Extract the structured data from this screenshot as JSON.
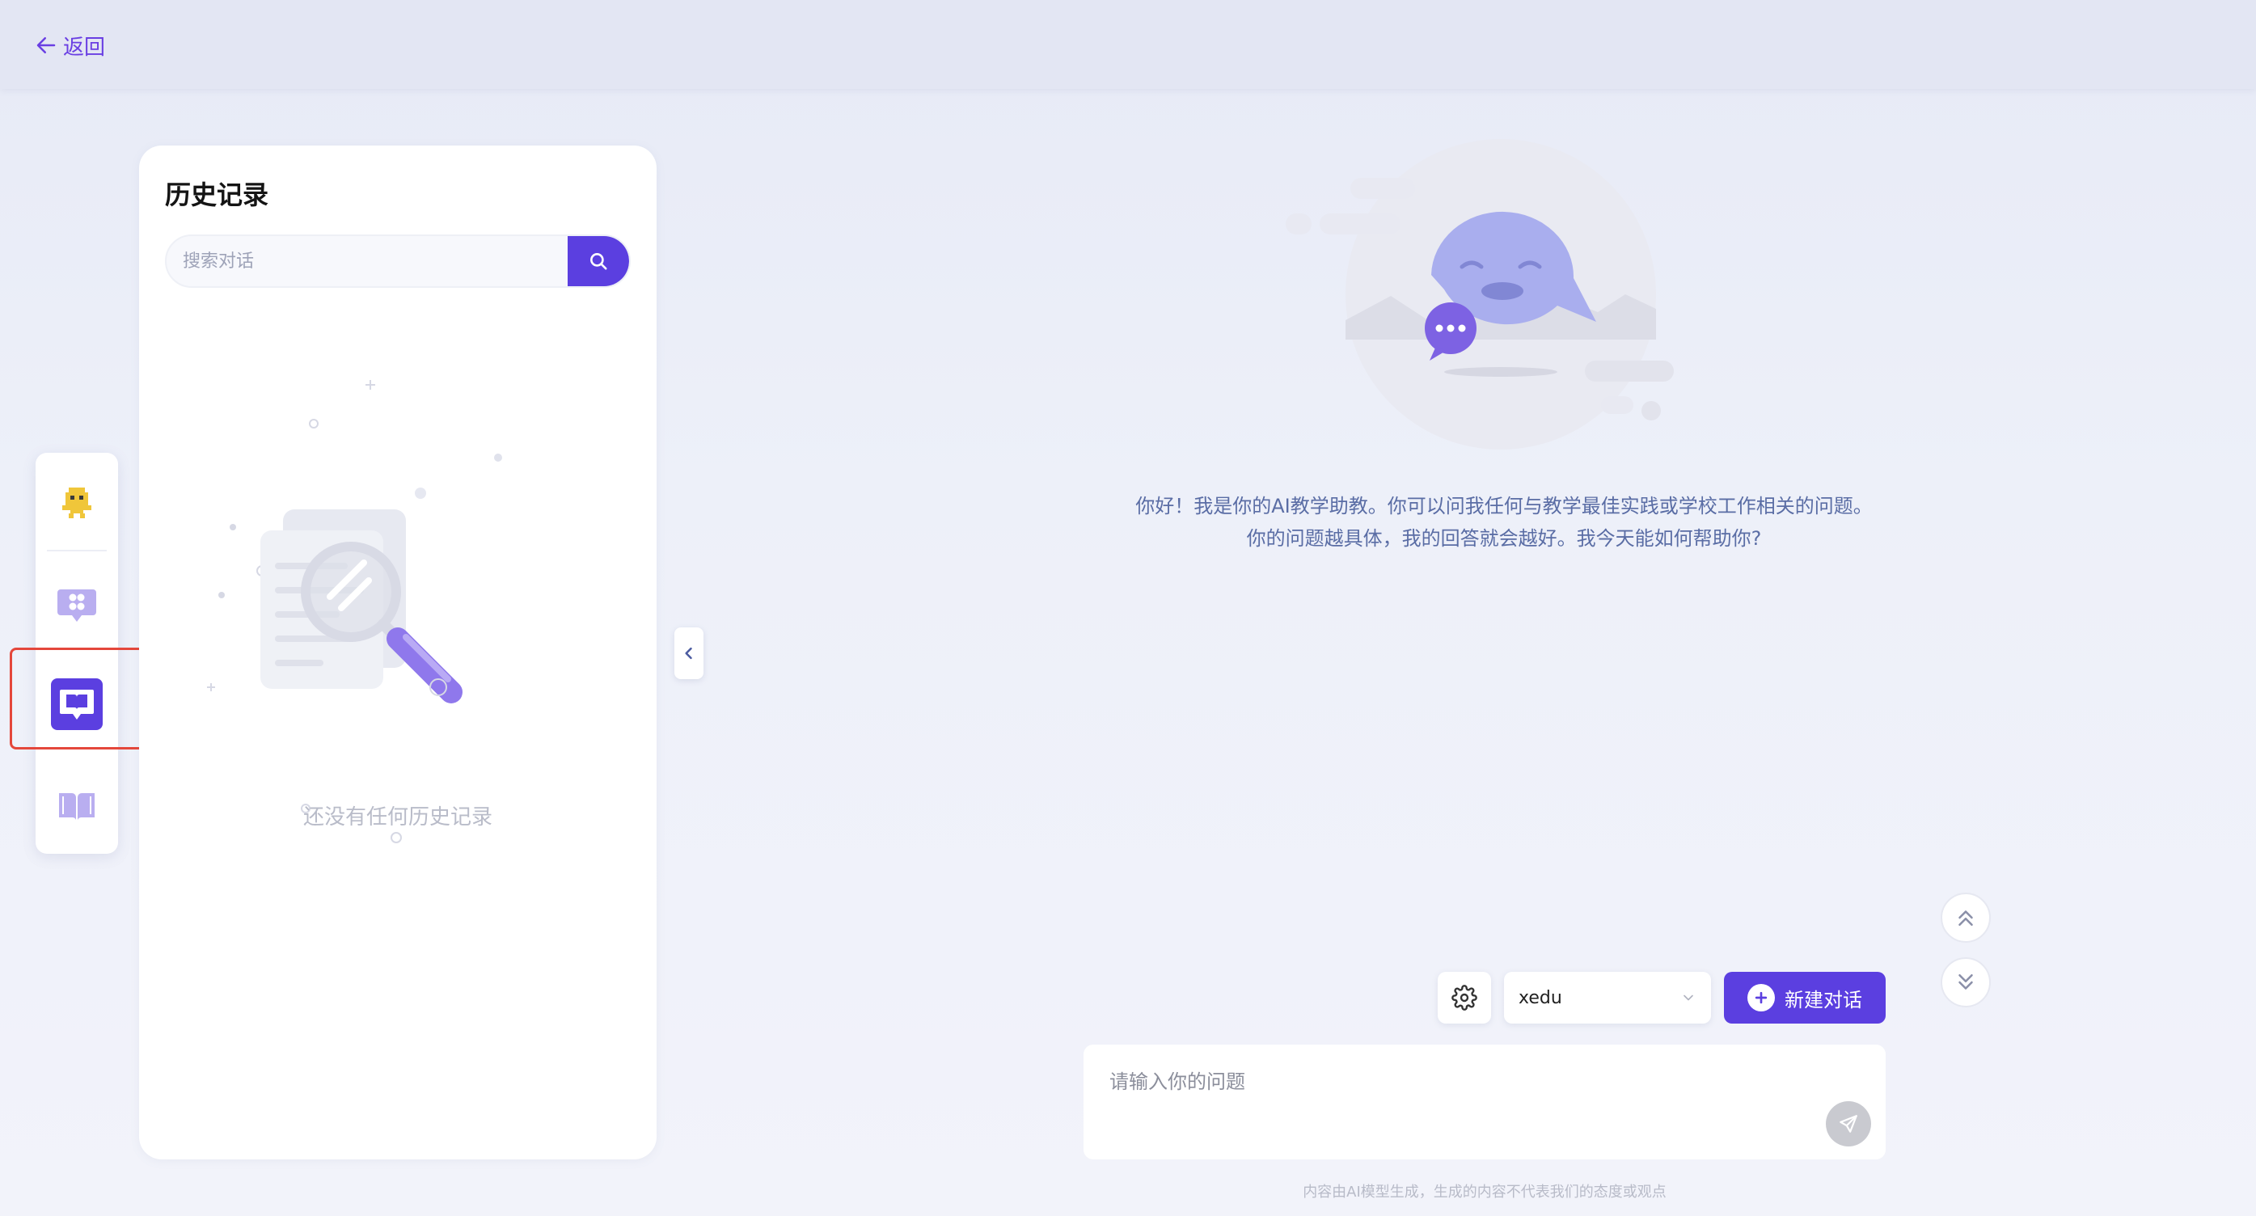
{
  "header": {
    "back_label": "返回",
    "back_icon": "arrow-left-icon"
  },
  "rail": {
    "items": [
      {
        "name": "robot",
        "icon": "robot-icon",
        "active": false
      },
      {
        "name": "apps-chat",
        "icon": "apps-chat-icon",
        "active": false
      },
      {
        "name": "book-chat",
        "icon": "book-chat-icon",
        "active": true
      },
      {
        "name": "book",
        "icon": "book-icon",
        "active": false
      }
    ]
  },
  "history": {
    "title": "历史记录",
    "search_placeholder": "搜索对话",
    "empty_text": "还没有任何历史记录"
  },
  "chat": {
    "intro_line1": "你好！我是你的AI教学助教。你可以问我任何与教学最佳实践或学校工作相关的问题。",
    "intro_line2": "你的问题越具体，我的回答就会越好。我今天能如何帮助你?"
  },
  "controls": {
    "model_value": "xedu",
    "new_chat_label": "新建对话",
    "input_placeholder": "请输入你的问题",
    "disclaimer": "内容由AI模型生成，生成的内容不代表我们的态度或观点"
  },
  "colors": {
    "accent": "#5b3fe0",
    "annotation_red": "#e4473b",
    "intro_text": "#5a6da5"
  }
}
